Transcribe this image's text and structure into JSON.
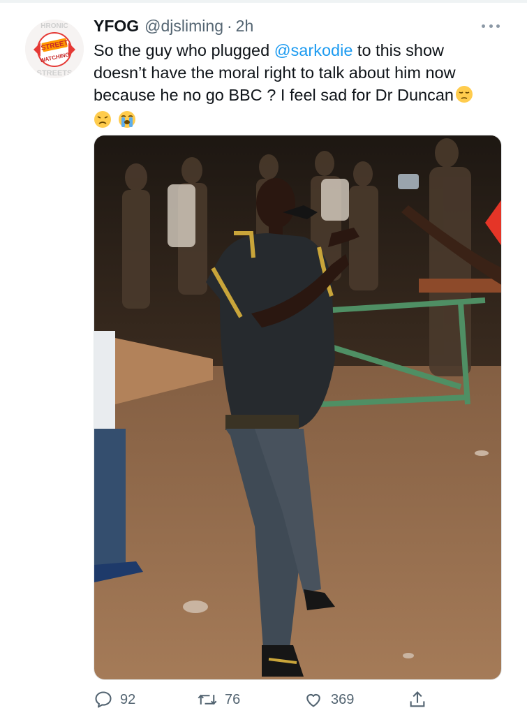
{
  "tweet": {
    "display_name": "YFOG",
    "handle": "@djsliming",
    "separator": "·",
    "time": "2h",
    "text_before_mention": "So the guy who plugged ",
    "mention": "@sarkodie",
    "text_after_mention": " to this show doesn’t have the moral right to talk about him now because he no go BBC ? I feel sad for Dr Duncan",
    "emojis": [
      "pensive-face",
      "disappointed-face",
      "loudly-crying-face"
    ]
  },
  "avatar": {
    "logo_text_top": "STREET",
    "logo_text_bottom": "WATCHING",
    "ring_text_top": "HRONIC",
    "ring_text_bottom": "STREETS"
  },
  "media": {
    "description_kind": "photo"
  },
  "actions": {
    "replies": "92",
    "retweets": "76",
    "likes": "369"
  },
  "colors": {
    "link": "#1d9bf0",
    "secondary_text": "#536471",
    "primary_text": "#0f1419"
  }
}
